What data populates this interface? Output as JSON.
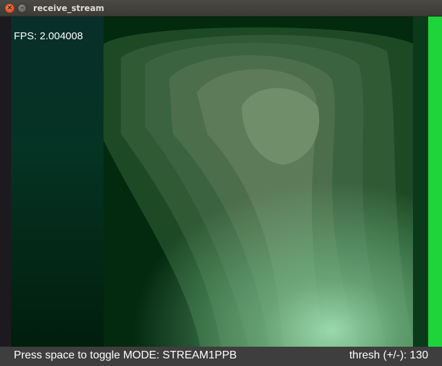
{
  "window": {
    "title": "receive_stream",
    "close_glyph": "×",
    "minimize_glyph": "–",
    "close_icon": "close-icon",
    "minimize_icon": "minimize-icon"
  },
  "overlay": {
    "fps_text": "FPS: 2.004008"
  },
  "status": {
    "mode_text": "Press space to toggle MODE: STREAM1PPB",
    "thresh_text": "thresh (+/-): 130"
  },
  "colors": {
    "titlebar": "#3c3b37",
    "status_bar": "#3e3e3e",
    "frame_dark": "#032a13",
    "frame_mid": "#4d6e47",
    "frame_light": "#8fd0a0",
    "right_edge_green": "#1fd33a",
    "close_button": "#e0531f"
  }
}
